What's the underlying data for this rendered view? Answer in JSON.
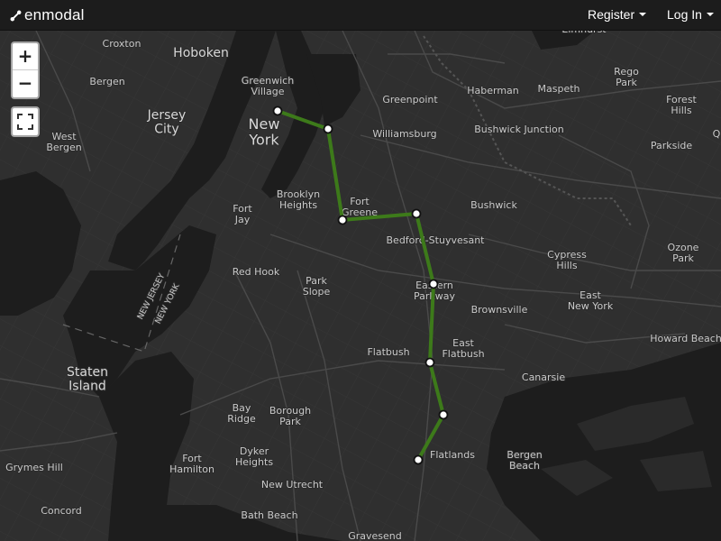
{
  "app": {
    "brand": "enmodal",
    "register_label": "Register",
    "login_label": "Log In"
  },
  "colors": {
    "navbar": "#1c1c1c",
    "land": "#2f2f2f",
    "water": "#1e1e1e",
    "roads": "#3b3b3b",
    "line": "#3d7a1a",
    "station_fill": "#ffffff",
    "station_stroke": "#111111"
  },
  "map_controls": {
    "zoom_in": "+",
    "zoom_out": "−",
    "fullscreen_icon": "fullscreen-icon"
  },
  "map_labels": [
    {
      "id": "croxton",
      "text": "Croxton"
    },
    {
      "id": "hoboken",
      "text": "Hoboken"
    },
    {
      "id": "greenwich-village",
      "text": "Greenwich\nVillage"
    },
    {
      "id": "elmhurst",
      "text": "Elmhurst"
    },
    {
      "id": "rego-park",
      "text": "Rego\nPark"
    },
    {
      "id": "bergen",
      "text": "Bergen"
    },
    {
      "id": "jersey-city",
      "text": "Jersey\nCity"
    },
    {
      "id": "new-york",
      "text": "New\nYork"
    },
    {
      "id": "greenpoint",
      "text": "Greenpoint"
    },
    {
      "id": "haberman",
      "text": "Haberman"
    },
    {
      "id": "maspeth",
      "text": "Maspeth"
    },
    {
      "id": "forest-hills",
      "text": "Forest\nHills"
    },
    {
      "id": "west-bergen",
      "text": "West\nBergen"
    },
    {
      "id": "williamsburg",
      "text": "Williamsburg"
    },
    {
      "id": "bushwick-junction",
      "text": "Bushwick Junction"
    },
    {
      "id": "parkside",
      "text": "Parkside"
    },
    {
      "id": "q",
      "text": "Q"
    },
    {
      "id": "brooklyn-heights",
      "text": "Brooklyn\nHeights"
    },
    {
      "id": "fort-greene",
      "text": "Fort\nGreene"
    },
    {
      "id": "bushwick",
      "text": "Bushwick"
    },
    {
      "id": "fort-jay",
      "text": "Fort\nJay"
    },
    {
      "id": "bedford-stuyvesant",
      "text": "Bedford-Stuyvesant"
    },
    {
      "id": "cypress-hills",
      "text": "Cypress\nHills"
    },
    {
      "id": "ozone-park",
      "text": "Ozone\nPark"
    },
    {
      "id": "red-hook",
      "text": "Red Hook"
    },
    {
      "id": "park-slope",
      "text": "Park\nSlope"
    },
    {
      "id": "eastern-parkway",
      "text": "Eastern\nParkway"
    },
    {
      "id": "east-new-york",
      "text": "East\nNew York"
    },
    {
      "id": "new-jersey",
      "text": "NEW JERSEY"
    },
    {
      "id": "new-york-state",
      "text": "NEW YORK"
    },
    {
      "id": "brownsville",
      "text": "Brownsville"
    },
    {
      "id": "howard-beach",
      "text": "Howard Beach"
    },
    {
      "id": "flatbush",
      "text": "Flatbush"
    },
    {
      "id": "east-flatbush",
      "text": "East\nFlatbush"
    },
    {
      "id": "staten-island",
      "text": "Staten\nIsland"
    },
    {
      "id": "canarsie",
      "text": "Canarsie"
    },
    {
      "id": "bay-ridge",
      "text": "Bay\nRidge"
    },
    {
      "id": "borough-park",
      "text": "Borough\nPark"
    },
    {
      "id": "fort-hamilton",
      "text": "Fort\nHamilton"
    },
    {
      "id": "dyker-heights",
      "text": "Dyker\nHeights"
    },
    {
      "id": "flatlands",
      "text": "Flatlands"
    },
    {
      "id": "bergen-beach",
      "text": "Bergen\nBeach"
    },
    {
      "id": "grymes-hill",
      "text": "Grymes Hill"
    },
    {
      "id": "new-utrecht",
      "text": "New Utrecht"
    },
    {
      "id": "concord",
      "text": "Concord"
    },
    {
      "id": "bath-beach",
      "text": "Bath Beach"
    },
    {
      "id": "gravesend",
      "text": "Gravesend"
    }
  ],
  "transit_line": {
    "stations": [
      "s1",
      "s2",
      "s3",
      "s4",
      "s5",
      "s6",
      "s7",
      "s8"
    ]
  }
}
